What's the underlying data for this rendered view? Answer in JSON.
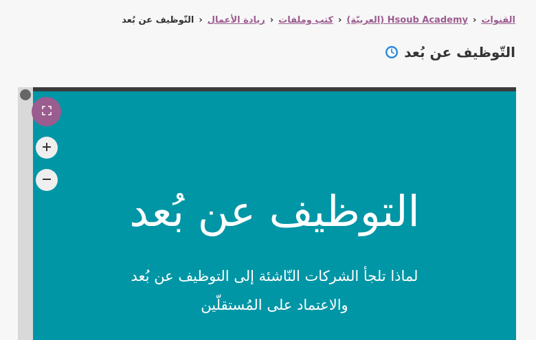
{
  "breadcrumb": {
    "items": [
      {
        "label": "القنوات"
      },
      {
        "label": "Hsoub Academy (العربيّة)"
      },
      {
        "label": "كتب وملفات"
      },
      {
        "label": "ريادة الأعمال"
      }
    ],
    "current": "التّوظيف عن بُعد",
    "separator": "‹"
  },
  "page": {
    "title": "التّوظيف عن بُعد",
    "title_icon": "clock-icon"
  },
  "viewer": {
    "controls": {
      "fullscreen_icon": "expand-icon",
      "zoom_in_icon": "plus-icon",
      "zoom_out_icon": "minus-icon"
    },
    "slide": {
      "title": "التوظيف عن بُعد",
      "subtitle_line1": "لماذا تلجأ الشركات النّاشئة إلى التوظيف عن بُعد",
      "subtitle_line2": "والاعتماد على المُستقلّين",
      "background": "#0096a6"
    }
  },
  "colors": {
    "accent": "#9b5c8f",
    "link": "#9b5c8f",
    "clock": "#2a8ae0"
  }
}
